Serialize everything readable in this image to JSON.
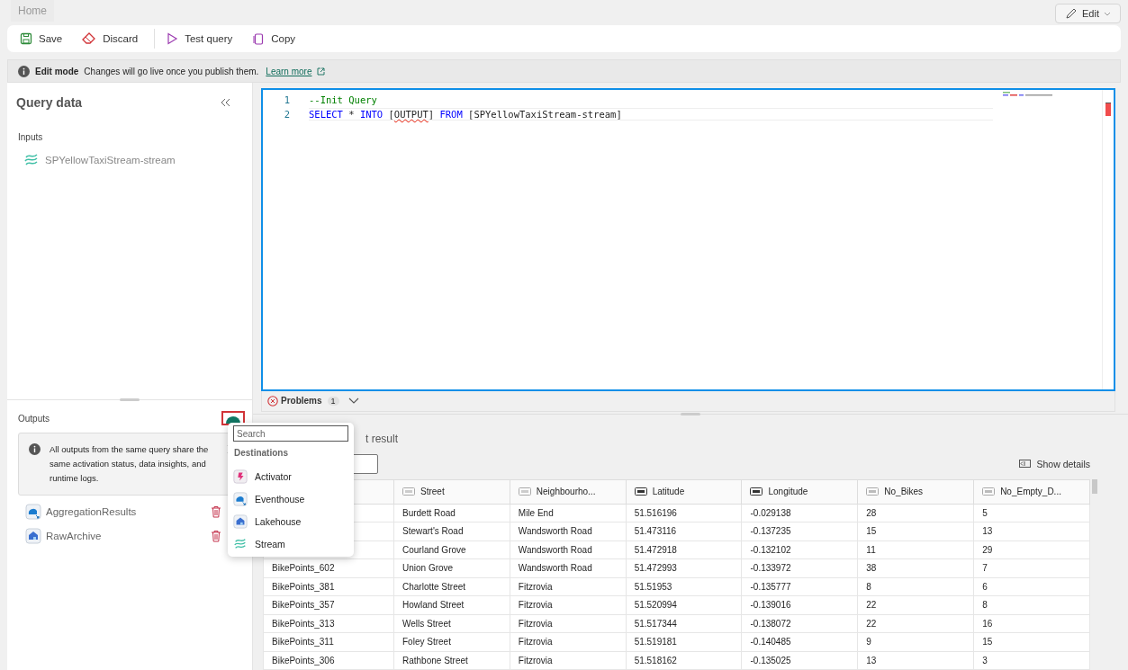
{
  "top_bar": {
    "tab": "Home",
    "edit_button": "Edit"
  },
  "toolbar": [
    {
      "label": "Save",
      "kind": "save"
    },
    {
      "label": "Discard",
      "kind": "discard"
    },
    {
      "label": "Test query",
      "kind": "test"
    },
    {
      "label": "Copy",
      "kind": "copy"
    }
  ],
  "banner": {
    "title": "Edit mode",
    "message": "Changes will go live once you publish them.",
    "link": "Learn more"
  },
  "sidebar": {
    "title": "Query data",
    "inputs_label": "Inputs",
    "inputs": [
      {
        "label": "SPYellowTaxiStream-stream",
        "kind": "stream"
      }
    ],
    "outputs_label": "Outputs",
    "info": "All outputs from the same query share the same activation status, data insights, and runtime logs.",
    "outputs": [
      {
        "label": "AggregationResults",
        "kind": "eventhouse"
      },
      {
        "label": "RawArchive",
        "kind": "lakehouse"
      }
    ]
  },
  "editor": {
    "lines": [
      {
        "number": "1",
        "tokens": [
          {
            "text": "--Init Query",
            "kind": "comment"
          }
        ]
      },
      {
        "number": "2",
        "tokens": [
          {
            "text": "SELECT",
            "kind": "keyword"
          },
          {
            "text": " * ",
            "kind": "plain"
          },
          {
            "text": "INTO",
            "kind": "keyword"
          },
          {
            "text": " [",
            "kind": "plain"
          },
          {
            "text": "OUTPUT",
            "kind": "error"
          },
          {
            "text": "] ",
            "kind": "plain"
          },
          {
            "text": "FROM",
            "kind": "keyword"
          },
          {
            "text": " [SPYellowTaxiStream-stream]",
            "kind": "plain"
          }
        ]
      }
    ],
    "problems_label": "Problems",
    "problems_count": "1"
  },
  "results": {
    "title_fragment": "t result",
    "show_details": "Show details",
    "columns": [
      {
        "label": "Street",
        "kind": "text"
      },
      {
        "label": "Neighbourho...",
        "kind": "text"
      },
      {
        "label": "Latitude",
        "kind": "decimal"
      },
      {
        "label": "Longitude",
        "kind": "decimal"
      },
      {
        "label": "No_Bikes",
        "kind": "integer"
      },
      {
        "label": "No_Empty_D...",
        "kind": "integer"
      }
    ],
    "rows": [
      {
        "cells": [
          "Burdett Road",
          "Mile End",
          "51.516196",
          "-0.029138",
          "28",
          "5"
        ]
      },
      {
        "cells": [
          "Stewart's Road",
          "Wandsworth Road",
          "51.473116",
          "-0.137235",
          "15",
          "13"
        ]
      },
      {
        "cells": [
          "Courland Grove",
          "Wandsworth Road",
          "51.472918",
          "-0.132102",
          "11",
          "29"
        ]
      },
      {
        "cells": [
          "BikePoints_602",
          "Union Grove",
          "Wandsworth Road",
          "51.472993",
          "-0.133972",
          "38",
          "7"
        ]
      },
      {
        "cells": [
          "BikePoints_381",
          "Charlotte Street",
          "Fitzrovia",
          "51.51953",
          "-0.135777",
          "8",
          "6"
        ]
      },
      {
        "cells": [
          "BikePoints_357",
          "Howland Street",
          "Fitzrovia",
          "51.520994",
          "-0.139016",
          "22",
          "8"
        ]
      },
      {
        "cells": [
          "BikePoints_313",
          "Wells Street",
          "Fitzrovia",
          "51.517344",
          "-0.138072",
          "22",
          "16"
        ]
      },
      {
        "cells": [
          "BikePoints_311",
          "Foley Street",
          "Fitzrovia",
          "51.519181",
          "-0.140485",
          "9",
          "15"
        ]
      },
      {
        "cells": [
          "BikePoints_306",
          "Rathbone Street",
          "Fitzrovia",
          "51.518162",
          "-0.135025",
          "13",
          "3"
        ]
      }
    ]
  },
  "dropdown": {
    "search_placeholder": "Search",
    "section": "Destinations",
    "items": [
      {
        "label": "Activator",
        "kind": "activator"
      },
      {
        "label": "Eventhouse",
        "kind": "eventhouse"
      },
      {
        "label": "Lakehouse",
        "kind": "lakehouse"
      },
      {
        "label": "Stream",
        "kind": "stream"
      }
    ]
  }
}
